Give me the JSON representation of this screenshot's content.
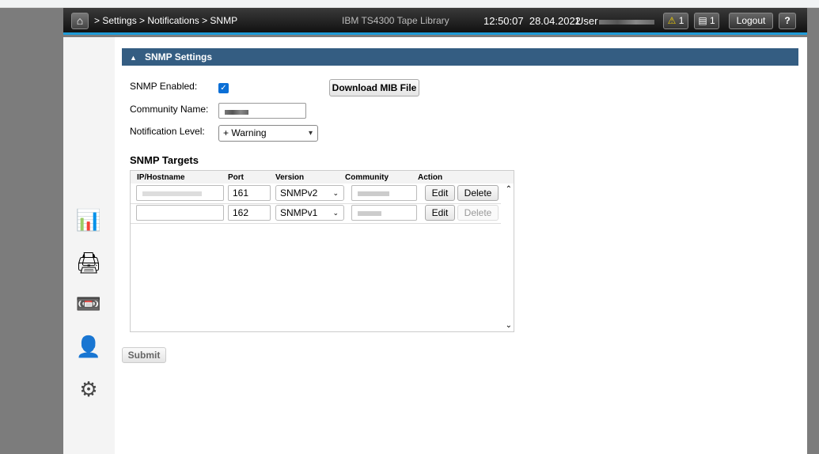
{
  "header": {
    "breadcrumb": "> Settings > Notifications > SNMP",
    "title": "IBM TS4300 Tape Library",
    "time": "12:50:07",
    "date": "28.04.2022",
    "user_label": "User",
    "alerts_count": "1",
    "tasks_count": "1",
    "logout": "Logout",
    "help": "?"
  },
  "panel": {
    "title": "SNMP Settings",
    "snmp_enabled_label": "SNMP Enabled:",
    "snmp_enabled": true,
    "download_mib": "Download MIB File",
    "community_label": "Community Name:",
    "notification_label": "Notification Level:",
    "notification_value": "+ Warning"
  },
  "targets": {
    "title": "SNMP Targets",
    "columns": [
      "IP/Hostname",
      "Port",
      "Version",
      "Community",
      "Action"
    ],
    "rows": [
      {
        "port": "161",
        "version": "SNMPv2",
        "edit": "Edit",
        "delete": "Delete",
        "delete_enabled": true
      },
      {
        "port": "162",
        "version": "SNMPv1",
        "edit": "Edit",
        "delete": "Delete",
        "delete_enabled": false
      }
    ]
  },
  "submit": "Submit",
  "sidebar": {
    "icons": [
      "monitoring-icon",
      "library-drive-icon",
      "tape-cartridge-icon",
      "user-icon",
      "settings-gears-icon"
    ]
  }
}
